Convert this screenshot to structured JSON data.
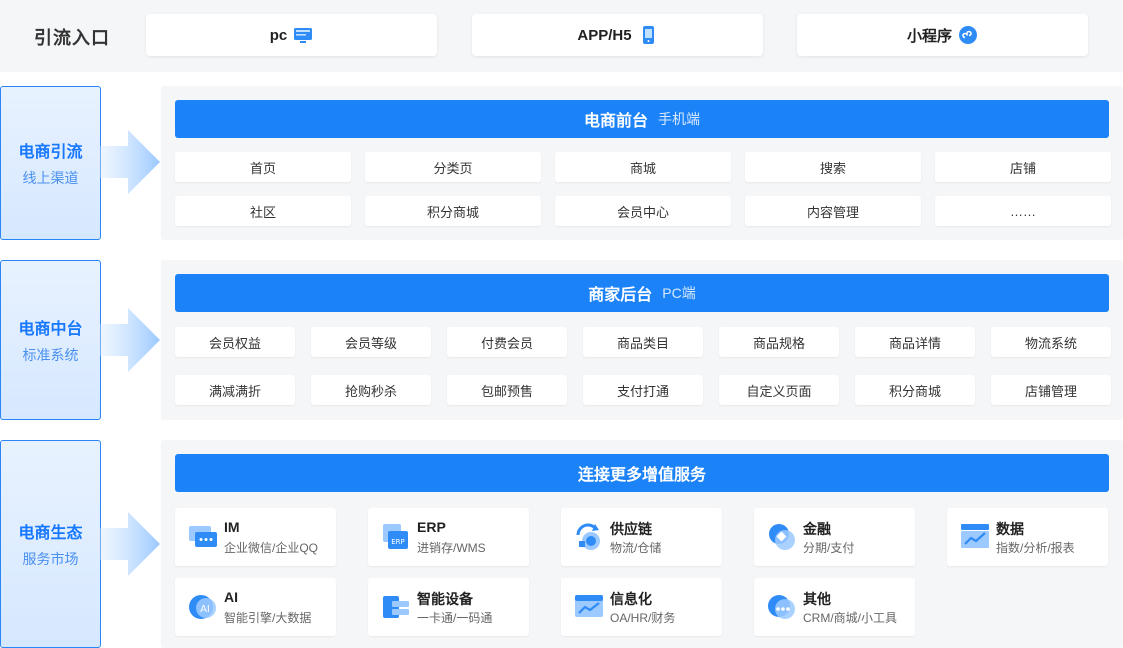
{
  "entry": {
    "label": "引流入口",
    "items": [
      {
        "label": "pc",
        "icon": "monitor-icon"
      },
      {
        "label": "APP/H5",
        "icon": "mobile-icon"
      },
      {
        "label": "小程序",
        "icon": "mini-program-icon"
      }
    ]
  },
  "side": [
    {
      "title": "电商引流",
      "subtitle": "线上渠道"
    },
    {
      "title": "电商中台",
      "subtitle": "标准系统"
    },
    {
      "title": "电商生态",
      "subtitle": "服务市场"
    }
  ],
  "front": {
    "title": "电商前台",
    "subtitle": "手机端",
    "row1": [
      "首页",
      "分类页",
      "商城",
      "搜索",
      "店铺"
    ],
    "row2": [
      "社区",
      "积分商城",
      "会员中心",
      "内容管理",
      "……"
    ]
  },
  "back": {
    "title": "商家后台",
    "subtitle": "PC端",
    "row1": [
      "会员权益",
      "会员等级",
      "付费会员",
      "商品类目",
      "商品规格",
      "商品详情",
      "物流系统"
    ],
    "row2": [
      "满减满折",
      "抢购秒杀",
      "包邮预售",
      "支付打通",
      "自定义页面",
      "积分商城",
      "店铺管理"
    ]
  },
  "services": {
    "title": "连接更多增值服务",
    "items": [
      {
        "name": "IM",
        "desc": "企业微信/企业QQ",
        "icon": "chat-icon"
      },
      {
        "name": "ERP",
        "desc": "进销存/WMS",
        "icon": "erp-icon"
      },
      {
        "name": "供应链",
        "desc": "物流/仓储",
        "icon": "supply-chain-icon"
      },
      {
        "name": "金融",
        "desc": "分期/支付",
        "icon": "finance-icon"
      },
      {
        "name": "数据",
        "desc": "指数/分析/报表",
        "icon": "data-chart-icon"
      },
      {
        "name": "AI",
        "desc": "智能引擎/大数据",
        "icon": "ai-icon"
      },
      {
        "name": "智能设备",
        "desc": "一卡通/一码通",
        "icon": "device-icon"
      },
      {
        "name": "信息化",
        "desc": "OA/HR/财务",
        "icon": "info-system-icon"
      },
      {
        "name": "其他",
        "desc": "CRM/商城/小工具",
        "icon": "more-icon"
      }
    ]
  },
  "colors": {
    "primary": "#1c82f7",
    "panel": "#f5f6f8",
    "side_border": "#2a86f5"
  }
}
